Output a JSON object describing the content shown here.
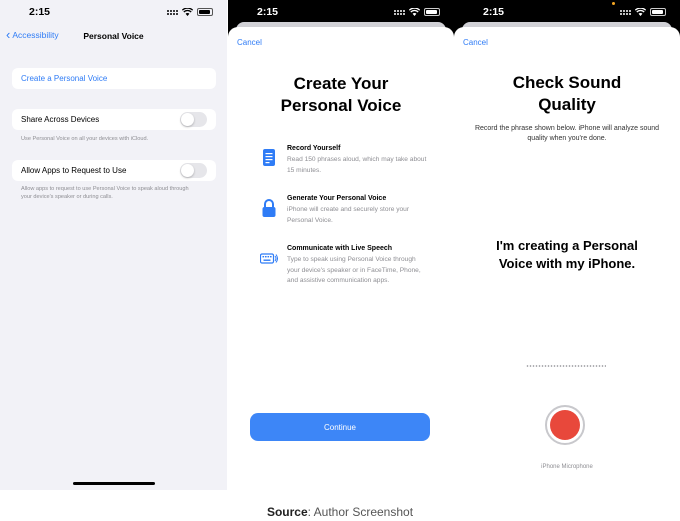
{
  "screen1": {
    "time": "2:15",
    "back_label": "Accessibility",
    "title": "Personal Voice",
    "create_link": "Create a Personal Voice",
    "share_label": "Share Across Devices",
    "share_footer": "Use Personal Voice on all your devices with iCloud.",
    "share_on": false,
    "allow_label": "Allow Apps to Request to Use",
    "allow_footer": "Allow apps to request to use Personal Voice to speak aloud through your device's speaker or during calls.",
    "allow_on": false
  },
  "screen2": {
    "time": "2:15",
    "cancel": "Cancel",
    "title_line1": "Create Your",
    "title_line2": "Personal Voice",
    "features": [
      {
        "icon": "document-icon",
        "title": "Record Yourself",
        "desc": "Read 150 phrases aloud, which may take about 15 minutes."
      },
      {
        "icon": "lock-icon",
        "title": "Generate Your Personal Voice",
        "desc": "iPhone will create and securely store your Personal Voice."
      },
      {
        "icon": "keyboard-speaker-icon",
        "title": "Communicate with Live Speech",
        "desc": "Type to speak using Personal Voice through your device's speaker or in FaceTime, Phone, and assistive communication apps."
      }
    ],
    "continue": "Continue"
  },
  "screen3": {
    "time": "2:15",
    "cancel": "Cancel",
    "title_line1": "Check Sound",
    "title_line2": "Quality",
    "subtitle": "Record the phrase shown below. iPhone will analyze sound quality when you're done.",
    "phrase_line1": "I'm creating a Personal",
    "phrase_line2": "Voice with my iPhone.",
    "mic_label": "iPhone Microphone"
  },
  "caption": {
    "source_label": "Source",
    "source_text": ": Author Screenshot"
  },
  "colors": {
    "accent": "#2f7cf6",
    "button": "#3d86f7",
    "record": "#e8483b",
    "grouped_bg": "#f2f2f7"
  }
}
